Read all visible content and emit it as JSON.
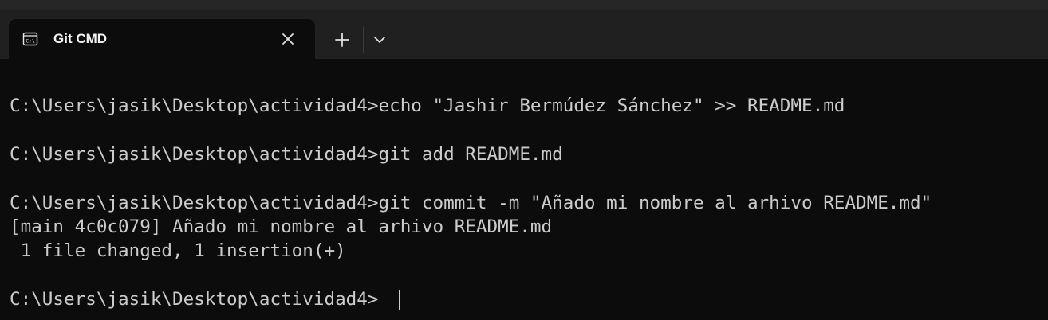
{
  "tab": {
    "title": "Git CMD",
    "icon": "console-icon"
  },
  "tabbar": {
    "new_tab_icon": "plus-icon",
    "dropdown_icon": "chevron-down-icon",
    "close_icon": "close-icon"
  },
  "terminal": {
    "lines": [
      "C:\\Users\\jasik\\Desktop\\actividad4>echo \"Jashir Bermúdez Sánchez\" >> README.md",
      "C:\\Users\\jasik\\Desktop\\actividad4>git add README.md",
      "C:\\Users\\jasik\\Desktop\\actividad4>git commit -m \"Añado mi nombre al arhivo README.md\"",
      "[main 4c0c079] Añado mi nombre al arhivo README.md",
      " 1 file changed, 1 insertion(+)",
      "C:\\Users\\jasik\\Desktop\\actividad4>"
    ]
  },
  "colors": {
    "background": "#0c0c0c",
    "titlebar": "#202020",
    "text": "#cccccc"
  }
}
